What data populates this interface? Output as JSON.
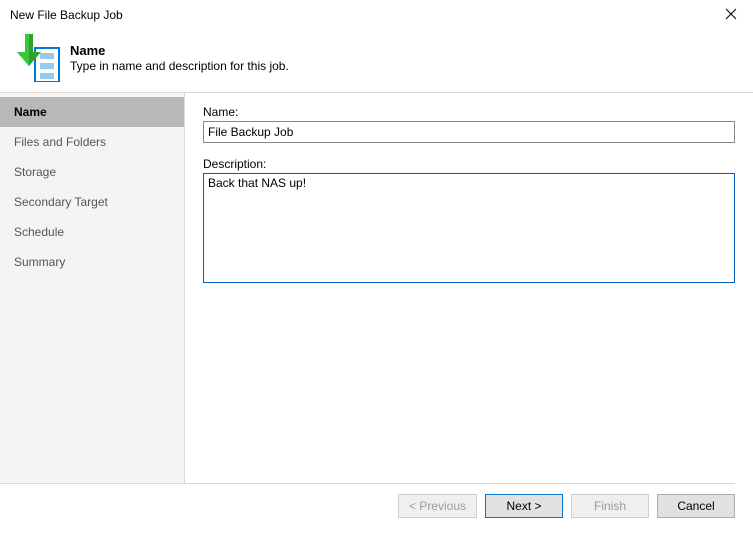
{
  "window": {
    "title": "New File Backup Job"
  },
  "header": {
    "title": "Name",
    "subtitle": "Type in name and description for this job."
  },
  "sidebar": {
    "items": [
      {
        "label": "Name",
        "active": true
      },
      {
        "label": "Files and Folders",
        "active": false
      },
      {
        "label": "Storage",
        "active": false
      },
      {
        "label": "Secondary Target",
        "active": false
      },
      {
        "label": "Schedule",
        "active": false
      },
      {
        "label": "Summary",
        "active": false
      }
    ]
  },
  "form": {
    "name_label": "Name:",
    "name_value": "File Backup Job",
    "description_label": "Description:",
    "description_value": "Back that NAS up!"
  },
  "buttons": {
    "previous": "< Previous",
    "next": "Next >",
    "finish": "Finish",
    "cancel": "Cancel"
  }
}
